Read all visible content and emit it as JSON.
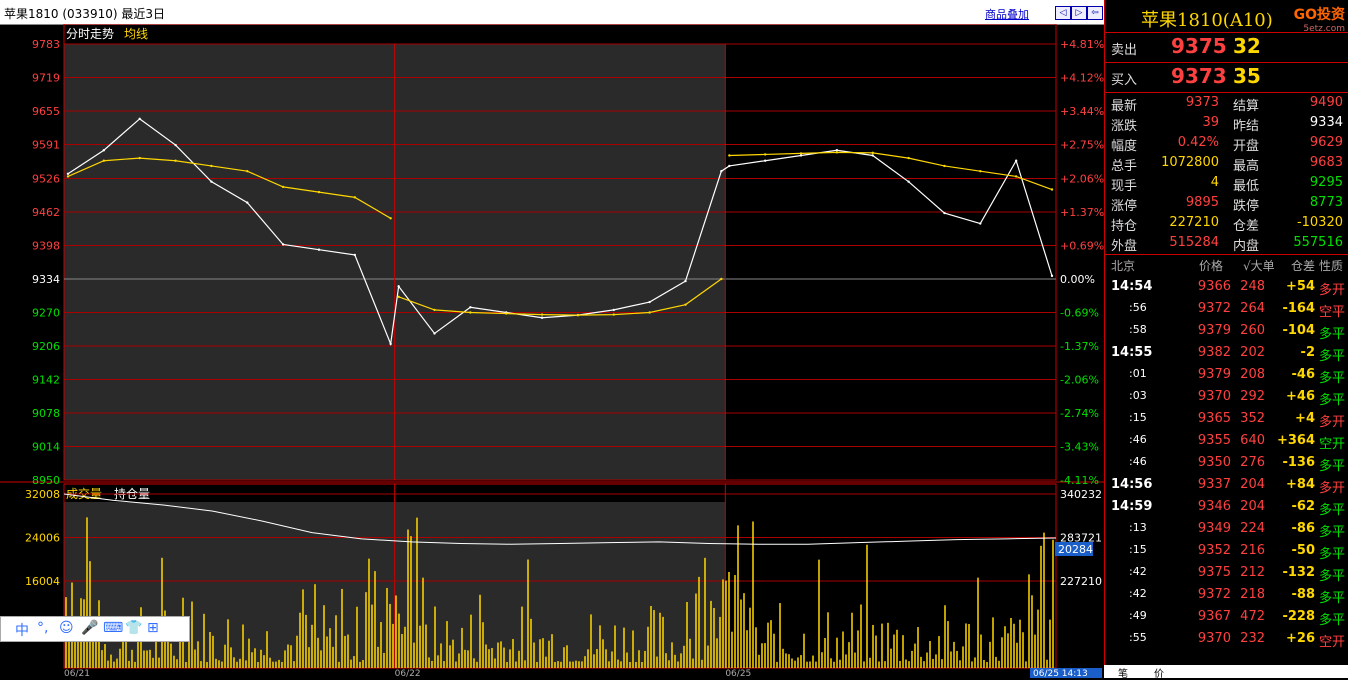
{
  "header": {
    "title": "苹果1810 (033910)  最近3日",
    "link": "商品叠加",
    "nav": [
      "◁",
      "▷",
      "⇦",
      "⇨"
    ]
  },
  "chart": {
    "panel_labels": {
      "main": "分时走势",
      "avg": "均线",
      "vol": "成交量",
      "oi": "持仓量"
    },
    "price_ticks": [
      "9783",
      "9719",
      "9655",
      "9591",
      "9526",
      "9462",
      "9398",
      "9334",
      "9270",
      "9206",
      "9142",
      "9078",
      "9014",
      "8950"
    ],
    "pct_ticks": [
      "+4.81%",
      "+4.12%",
      "+3.44%",
      "+2.75%",
      "+2.06%",
      "+1.37%",
      "+0.69%",
      "0.00%",
      "-0.69%",
      "-1.37%",
      "-2.06%",
      "-2.74%",
      "-3.43%",
      "-4.11%"
    ],
    "vol_ticks": [
      "32008",
      "24006",
      "16004"
    ],
    "oi_ticks": [
      "340232",
      "283721",
      "227210"
    ],
    "oi_badge": "20284",
    "date_labels": [
      "06/21",
      "06/22",
      "06/25"
    ],
    "time_badge": "06/25 14:13"
  },
  "chart_data": {
    "type": "line",
    "title": "分时走势",
    "series": [
      {
        "name": "分时走势",
        "color": "#ffffff",
        "x_day": [
          1,
          1,
          1,
          1,
          1,
          1,
          1,
          1,
          1,
          1,
          2,
          2,
          2,
          2,
          2,
          2,
          2,
          2,
          2,
          2,
          3,
          3,
          3,
          3,
          3,
          3,
          3,
          3,
          3,
          3
        ],
        "values": [
          9535,
          9580,
          9640,
          9590,
          9520,
          9480,
          9400,
          9390,
          9380,
          9210,
          9320,
          9230,
          9280,
          9270,
          9260,
          9265,
          9275,
          9290,
          9330,
          9540,
          9550,
          9560,
          9570,
          9580,
          9570,
          9520,
          9460,
          9440,
          9560,
          9340
        ]
      },
      {
        "name": "均线",
        "color": "#ffd700",
        "values": [
          9530,
          9560,
          9565,
          9560,
          9550,
          9540,
          9510,
          9500,
          9490,
          9450,
          9300,
          9275,
          9270,
          9268,
          9266,
          9265,
          9266,
          9270,
          9285,
          9334,
          9570,
          9572,
          9574,
          9576,
          9575,
          9565,
          9550,
          9540,
          9530,
          9505
        ]
      }
    ],
    "ylim": [
      8950,
      9783
    ],
    "volume": {
      "name": "成交量",
      "ylim": [
        0,
        32008
      ]
    },
    "open_interest": {
      "name": "持仓量",
      "ylim": [
        227210,
        340232
      ]
    }
  },
  "orderbook": {
    "title": "苹果1810(A",
    "title_suffix": "10)",
    "logo": "GO投资",
    "logo_sub": "5etz.com",
    "sell": {
      "label": "卖出",
      "price": "9375",
      "vol": "32"
    },
    "buy": {
      "label": "买入",
      "price": "9373",
      "vol": "35"
    }
  },
  "quote": [
    {
      "l1": "最新",
      "v1": "9373",
      "c1": "red",
      "l2": "结算",
      "v2": "9490",
      "c2": "red"
    },
    {
      "l1": "涨跌",
      "v1": "39",
      "c1": "red",
      "l2": "昨结",
      "v2": "9334",
      "c2": "white"
    },
    {
      "l1": "幅度",
      "v1": "0.42%",
      "c1": "red",
      "l2": "开盘",
      "v2": "9629",
      "c2": "red"
    },
    {
      "l1": "总手",
      "v1": "1072800",
      "c1": "yellow",
      "l2": "最高",
      "v2": "9683",
      "c2": "red"
    },
    {
      "l1": "现手",
      "v1": "4",
      "c1": "yellow",
      "l2": "最低",
      "v2": "9295",
      "c2": "green"
    },
    {
      "l1": "涨停",
      "v1": "9895",
      "c1": "red",
      "l2": "跌停",
      "v2": "8773",
      "c2": "green"
    },
    {
      "l1": "持仓",
      "v1": "227210",
      "c1": "yellow",
      "l2": "仓差",
      "v2": "-10320",
      "c2": "yellow"
    },
    {
      "l1": "外盘",
      "v1": "515284",
      "c1": "red",
      "l2": "内盘",
      "v2": "557516",
      "c2": "green"
    }
  ],
  "trades_header": {
    "city": "北京",
    "price": "价格",
    "big": "√大单",
    "diff": "仓差",
    "nature": "性质"
  },
  "trades": [
    {
      "t": "14:54",
      "p": "9366",
      "v": "248",
      "d": "+54",
      "n": "多开",
      "nc": "red",
      "dc": "yellow"
    },
    {
      "t": ":56",
      "p": "9372",
      "v": "264",
      "d": "-164",
      "n": "空平",
      "nc": "red",
      "dc": "yellow"
    },
    {
      "t": ":58",
      "p": "9379",
      "v": "260",
      "d": "-104",
      "n": "多平",
      "nc": "green",
      "dc": "yellow"
    },
    {
      "t": "14:55",
      "p": "9382",
      "v": "202",
      "d": "-2",
      "n": "多平",
      "nc": "green",
      "dc": "yellow"
    },
    {
      "t": ":01",
      "p": "9379",
      "v": "208",
      "d": "-46",
      "n": "多平",
      "nc": "green",
      "dc": "yellow"
    },
    {
      "t": ":03",
      "p": "9370",
      "v": "292",
      "d": "+46",
      "n": "多平",
      "nc": "green",
      "dc": "yellow"
    },
    {
      "t": ":15",
      "p": "9365",
      "v": "352",
      "d": "+4",
      "n": "多开",
      "nc": "red",
      "dc": "yellow"
    },
    {
      "t": ":46",
      "p": "9355",
      "v": "640",
      "d": "+364",
      "n": "空开",
      "nc": "green",
      "dc": "yellow"
    },
    {
      "t": ":46",
      "p": "9350",
      "v": "276",
      "d": "-136",
      "n": "多平",
      "nc": "green",
      "dc": "yellow"
    },
    {
      "t": "14:56",
      "p": "9337",
      "v": "204",
      "d": "+84",
      "n": "多开",
      "nc": "red",
      "dc": "yellow"
    },
    {
      "t": "14:59",
      "p": "9346",
      "v": "204",
      "d": "-62",
      "n": "多平",
      "nc": "green",
      "dc": "yellow"
    },
    {
      "t": ":13",
      "p": "9349",
      "v": "224",
      "d": "-86",
      "n": "多平",
      "nc": "green",
      "dc": "yellow"
    },
    {
      "t": ":15",
      "p": "9352",
      "v": "216",
      "d": "-50",
      "n": "多平",
      "nc": "green",
      "dc": "yellow"
    },
    {
      "t": ":42",
      "p": "9375",
      "v": "212",
      "d": "-132",
      "n": "多平",
      "nc": "green",
      "dc": "yellow"
    },
    {
      "t": ":42",
      "p": "9372",
      "v": "218",
      "d": "-88",
      "n": "多平",
      "nc": "green",
      "dc": "yellow"
    },
    {
      "t": ":49",
      "p": "9367",
      "v": "472",
      "d": "-228",
      "n": "多平",
      "nc": "green",
      "dc": "yellow"
    },
    {
      "t": ":55",
      "p": "9370",
      "v": "232",
      "d": "+26",
      "n": "空开",
      "nc": "red",
      "dc": "yellow"
    }
  ],
  "ime": {
    "items": [
      "中",
      "°,",
      "☺",
      "🎤",
      "⌨",
      "👕",
      "⊞"
    ]
  },
  "bottom_tabs": [
    "笔",
    "价"
  ]
}
